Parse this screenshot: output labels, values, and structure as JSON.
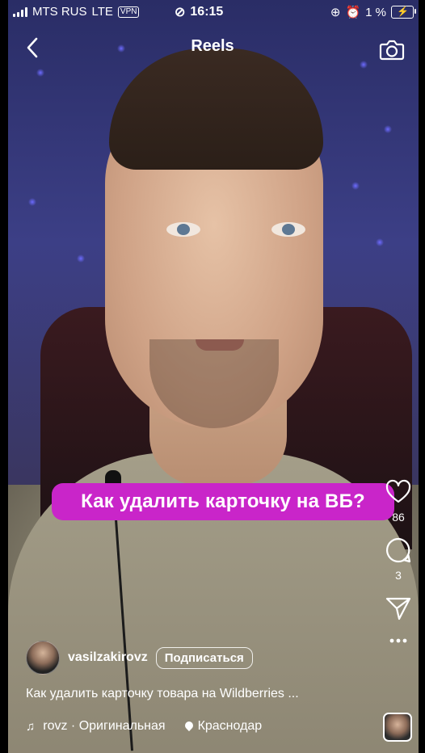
{
  "status_bar": {
    "carrier": "MTS RUS",
    "network": "LTE",
    "vpn": "VPN",
    "time": "16:15",
    "battery": "1 %"
  },
  "header": {
    "title": "Reels"
  },
  "video": {
    "overlay_caption": "Как удалить карточку на ВБ?"
  },
  "actions": {
    "likes": "86",
    "comments": "3"
  },
  "author": {
    "username": "vasilzakirovz",
    "subscribe_label": "Подписаться"
  },
  "description": "Как удалить карточку товара на Wildberries ...",
  "audio": {
    "label": "rovz · Оригинальная",
    "location": "Краснодар"
  },
  "icons": {
    "back": "chevron-left-icon",
    "camera": "camera-icon",
    "like": "heart-icon",
    "comment": "comment-icon",
    "share": "send-icon",
    "more": "more-dots-icon",
    "music": "music-note-icon",
    "location": "location-pin-icon"
  },
  "colors": {
    "caption_bg": "#c925c9",
    "battery_bolt": "#f6d13d"
  }
}
